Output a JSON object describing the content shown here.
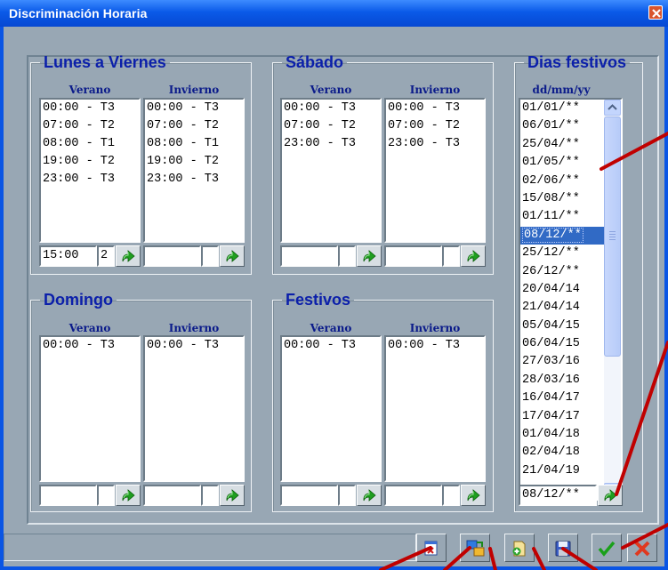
{
  "window": {
    "title": "Discriminación Horaria"
  },
  "groups": {
    "weekdays": {
      "title": "Lunes a Viernes",
      "summer": {
        "header": "Verano",
        "items": [
          "00:00 - T3",
          "07:00 - T2",
          "08:00 - T1",
          "19:00 - T2",
          "23:00 - T3"
        ],
        "time_value": "15:00",
        "tariff_value": "2"
      },
      "winter": {
        "header": "Invierno",
        "items": [
          "00:00 - T3",
          "07:00 - T2",
          "08:00 - T1",
          "19:00 - T2",
          "23:00 - T3"
        ],
        "time_value": "",
        "tariff_value": ""
      }
    },
    "saturday": {
      "title": "Sábado",
      "summer": {
        "header": "Verano",
        "items": [
          "00:00 - T3",
          "07:00 - T2",
          "23:00 - T3"
        ],
        "time_value": "",
        "tariff_value": ""
      },
      "winter": {
        "header": "Invierno",
        "items": [
          "00:00 - T3",
          "07:00 - T2",
          "23:00 - T3"
        ],
        "time_value": "",
        "tariff_value": ""
      }
    },
    "sunday": {
      "title": "Domingo",
      "summer": {
        "header": "Verano",
        "items": [
          "00:00 - T3"
        ],
        "time_value": "",
        "tariff_value": ""
      },
      "winter": {
        "header": "Invierno",
        "items": [
          "00:00 - T3"
        ],
        "time_value": "",
        "tariff_value": ""
      }
    },
    "holidays": {
      "title": "Festivos",
      "summer": {
        "header": "Verano",
        "items": [
          "00:00 - T3"
        ],
        "time_value": "",
        "tariff_value": ""
      },
      "winter": {
        "header": "Invierno",
        "items": [
          "00:00 - T3"
        ],
        "time_value": "",
        "tariff_value": ""
      }
    }
  },
  "holidays_list": {
    "title": "Dias festivos",
    "header": "dd/mm/yy",
    "items": [
      "01/01/**",
      "06/01/**",
      "25/04/**",
      "01/05/**",
      "02/06/**",
      "15/08/**",
      "01/11/**",
      "08/12/**",
      "25/12/**",
      "26/12/**",
      "20/04/14",
      "21/04/14",
      "05/04/15",
      "06/04/15",
      "27/03/16",
      "28/03/16",
      "16/04/17",
      "17/04/17",
      "01/04/18",
      "02/04/18",
      "21/04/19"
    ],
    "selected": "08/12/**",
    "input_value": "08/12/**"
  },
  "statusbar": {
    "text": ""
  },
  "toolbar_icons": [
    "delete-icon",
    "transfer-icon",
    "new-file-icon",
    "save-icon",
    "ok-check-icon",
    "cancel-x-icon"
  ],
  "colors": {
    "titlebar": "#0a5ae8",
    "client_bg": "#98a7b4",
    "group_title": "#0b1faa",
    "selection": "#316ac5",
    "annotation": "#c00000",
    "go_arrow": "#1a9a1a"
  }
}
